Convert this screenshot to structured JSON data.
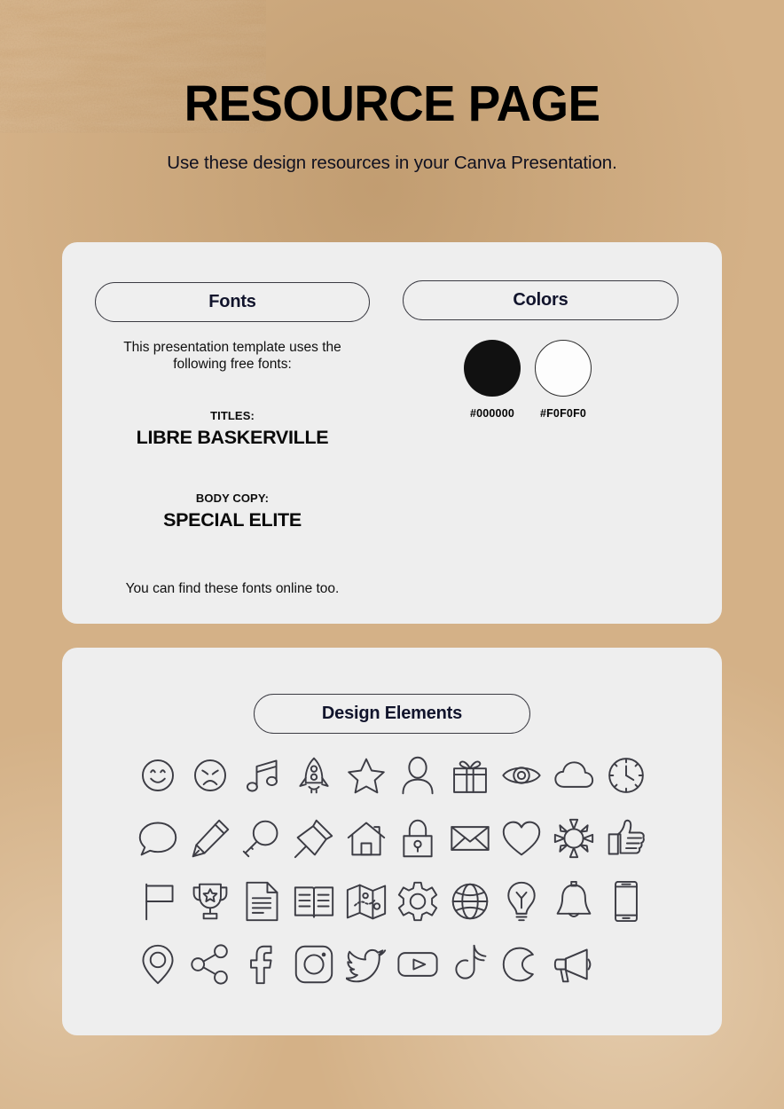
{
  "header": {
    "title": "RESOURCE PAGE",
    "subtitle": "Use these design resources in your Canva Presentation."
  },
  "fonts_panel": {
    "button_label": "Fonts",
    "intro": "This presentation template uses the following free fonts:",
    "titles_kicker": "TITLES:",
    "titles_font": "LIBRE BASKERVILLE",
    "body_kicker": "BODY COPY:",
    "body_font": "SPECIAL ELITE",
    "footer": "You can find these fonts online too."
  },
  "colors_panel": {
    "button_label": "Colors",
    "swatches": [
      {
        "label": "#000000",
        "hex": "#000000",
        "style": "dark"
      },
      {
        "label": "#F0F0F0",
        "hex": "#F0F0F0",
        "style": "light"
      }
    ]
  },
  "design_panel": {
    "button_label": "Design Elements",
    "icons": [
      "smiley-face-icon",
      "sad-face-icon",
      "music-note-icon",
      "rocket-icon",
      "star-icon",
      "person-icon",
      "gift-icon",
      "eye-icon",
      "cloud-icon",
      "clock-icon",
      "speech-bubble-icon",
      "pencil-icon",
      "magnifying-glass-icon",
      "pushpin-icon",
      "house-icon",
      "lock-icon",
      "envelope-icon",
      "heart-icon",
      "sun-icon",
      "thumbs-up-icon",
      "flag-icon",
      "trophy-icon",
      "document-icon",
      "open-book-icon",
      "map-icon",
      "gear-icon",
      "globe-icon",
      "lightbulb-icon",
      "bell-icon",
      "smartphone-icon",
      "location-pin-icon",
      "share-icon",
      "facebook-icon",
      "instagram-icon",
      "twitter-icon",
      "youtube-icon",
      "tiktok-icon",
      "moon-icon",
      "megaphone-icon"
    ]
  },
  "theme": {
    "background_color": "#d4b187",
    "panel_color": "#eeeeee",
    "text_color": "#11142c",
    "stroke_color": "#3c3c44"
  }
}
